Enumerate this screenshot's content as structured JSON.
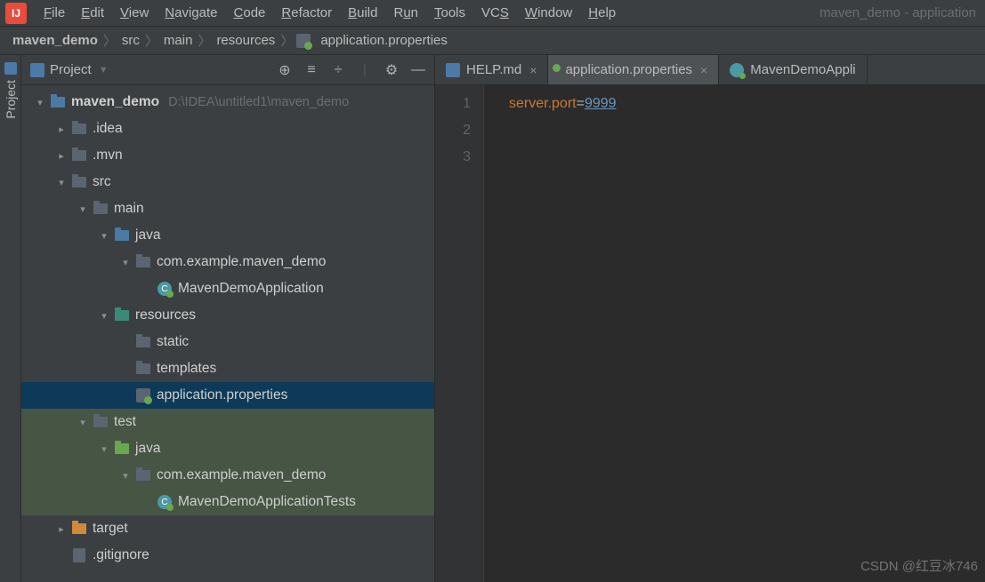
{
  "window_title": "maven_demo - application",
  "menus": [
    {
      "label": "File",
      "mn": 0
    },
    {
      "label": "Edit",
      "mn": 0
    },
    {
      "label": "View",
      "mn": 0
    },
    {
      "label": "Navigate",
      "mn": 0
    },
    {
      "label": "Code",
      "mn": 0
    },
    {
      "label": "Refactor",
      "mn": 0
    },
    {
      "label": "Build",
      "mn": 0
    },
    {
      "label": "Run",
      "mn": 1
    },
    {
      "label": "Tools",
      "mn": 0
    },
    {
      "label": "VCS",
      "mn": 2
    },
    {
      "label": "Window",
      "mn": 0
    },
    {
      "label": "Help",
      "mn": 0
    }
  ],
  "breadcrumbs": [
    "maven_demo",
    "src",
    "main",
    "resources",
    "application.properties"
  ],
  "sidebar_label": "Project",
  "panel_title": "Project",
  "tree": [
    {
      "indent": 0,
      "chev": "down",
      "icon": "folder-blue",
      "label": "maven_demo",
      "bold": true,
      "hint": "D:\\IDEA\\untitled1\\maven_demo"
    },
    {
      "indent": 1,
      "chev": "right",
      "icon": "folder",
      "label": ".idea"
    },
    {
      "indent": 1,
      "chev": "right",
      "icon": "folder",
      "label": ".mvn"
    },
    {
      "indent": 1,
      "chev": "down",
      "icon": "folder",
      "label": "src"
    },
    {
      "indent": 2,
      "chev": "down",
      "icon": "folder",
      "label": "main"
    },
    {
      "indent": 3,
      "chev": "down",
      "icon": "folder-blue",
      "label": "java"
    },
    {
      "indent": 4,
      "chev": "down",
      "icon": "folder",
      "label": "com.example.maven_demo"
    },
    {
      "indent": 5,
      "chev": "",
      "icon": "class",
      "label": "MavenDemoApplication"
    },
    {
      "indent": 3,
      "chev": "down",
      "icon": "folder-teal",
      "label": "resources"
    },
    {
      "indent": 4,
      "chev": "",
      "icon": "folder",
      "label": "static"
    },
    {
      "indent": 4,
      "chev": "",
      "icon": "folder",
      "label": "templates"
    },
    {
      "indent": 4,
      "chev": "",
      "icon": "prop",
      "label": "application.properties",
      "selected": true
    },
    {
      "indent": 2,
      "chev": "down",
      "icon": "folder",
      "label": "test",
      "hl": true
    },
    {
      "indent": 3,
      "chev": "down",
      "icon": "folder-green",
      "label": "java",
      "hl": true
    },
    {
      "indent": 4,
      "chev": "down",
      "icon": "folder",
      "label": "com.example.maven_demo",
      "hl": true
    },
    {
      "indent": 5,
      "chev": "",
      "icon": "class",
      "label": "MavenDemoApplicationTests",
      "hl": true
    },
    {
      "indent": 1,
      "chev": "right",
      "icon": "folder-orange",
      "label": "target"
    },
    {
      "indent": 1,
      "chev": "",
      "icon": "file",
      "label": ".gitignore"
    }
  ],
  "tabs": [
    {
      "label": "HELP.md",
      "icon": "md",
      "active": false,
      "closable": true
    },
    {
      "label": "application.properties",
      "icon": "prop",
      "active": true,
      "closable": true
    },
    {
      "label": "MavenDemoAppli",
      "icon": "cls",
      "active": false,
      "closable": false
    }
  ],
  "gutter": [
    "1",
    "2",
    "3"
  ],
  "code": {
    "key": "server.port",
    "op": "=",
    "val": "9999"
  },
  "watermark": "CSDN @红豆冰746"
}
